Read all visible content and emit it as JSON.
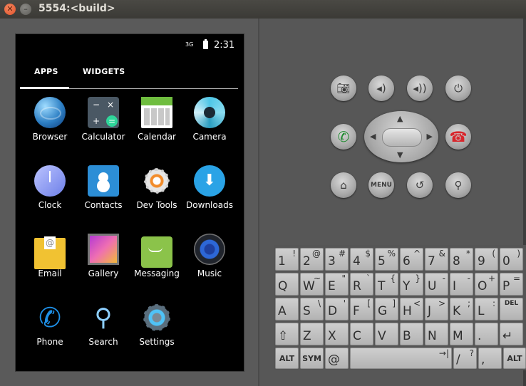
{
  "window": {
    "title": "5554:<build>"
  },
  "status_bar": {
    "signal": "3G",
    "time": "2:31"
  },
  "tabs": [
    {
      "label": "APPS"
    },
    {
      "label": "WIDGETS"
    }
  ],
  "apps": [
    {
      "label": "Browser"
    },
    {
      "label": "Calculator"
    },
    {
      "label": "Calendar"
    },
    {
      "label": "Camera"
    },
    {
      "label": "Clock"
    },
    {
      "label": "Contacts"
    },
    {
      "label": "Dev Tools"
    },
    {
      "label": "Downloads"
    },
    {
      "label": "Email"
    },
    {
      "label": "Gallery"
    },
    {
      "label": "Messaging"
    },
    {
      "label": "Music"
    },
    {
      "label": "Phone"
    },
    {
      "label": "Search"
    },
    {
      "label": "Settings"
    }
  ],
  "hardware_buttons": {
    "row1": [
      "camera-icon",
      "volume-down-icon",
      "volume-up-icon",
      "power-icon"
    ],
    "call": "call-icon",
    "end_call": "end-call-icon",
    "row3": [
      "home-icon",
      "menu",
      "back-icon",
      "search-icon"
    ],
    "menu_label": "MENU"
  },
  "keyboard": {
    "row1": [
      [
        "1",
        "!"
      ],
      [
        "2",
        "@"
      ],
      [
        "3",
        "#"
      ],
      [
        "4",
        "$"
      ],
      [
        "5",
        "%"
      ],
      [
        "6",
        "^"
      ],
      [
        "7",
        "&"
      ],
      [
        "8",
        "*"
      ],
      [
        "9",
        "("
      ],
      [
        "0",
        ")"
      ]
    ],
    "row2": [
      [
        "Q",
        ""
      ],
      [
        "W",
        "~"
      ],
      [
        "E",
        "\""
      ],
      [
        "R",
        "`"
      ],
      [
        "T",
        "{"
      ],
      [
        "Y",
        "}"
      ],
      [
        "U",
        "-"
      ],
      [
        "I",
        "-"
      ],
      [
        "O",
        "+"
      ],
      [
        "P",
        "="
      ]
    ],
    "row3": [
      [
        "A",
        ""
      ],
      [
        "S",
        "\\"
      ],
      [
        "D",
        "'"
      ],
      [
        "F",
        "["
      ],
      [
        "G",
        "]"
      ],
      [
        "H",
        "<"
      ],
      [
        "J",
        ">"
      ],
      [
        "K",
        ";"
      ],
      [
        "L",
        ":"
      ],
      [
        "DEL",
        ""
      ]
    ],
    "row4": [
      [
        "⇧",
        ""
      ],
      [
        "Z",
        ""
      ],
      [
        "X",
        ""
      ],
      [
        "C",
        ""
      ],
      [
        "V",
        ""
      ],
      [
        "B",
        ""
      ],
      [
        "N",
        ""
      ],
      [
        "M",
        ""
      ],
      [
        ".",
        ""
      ],
      [
        "↵",
        ""
      ]
    ],
    "row5": {
      "alt": "ALT",
      "sym": "SYM",
      "at": "@",
      "space_hint": "→|",
      "slash": "/",
      "slash_alt": "?",
      "comma": ",",
      "alt2": "ALT"
    }
  },
  "colors": {
    "call": "#1e8a2e",
    "end_call": "#d8262c",
    "close_button": "#e0512a"
  }
}
